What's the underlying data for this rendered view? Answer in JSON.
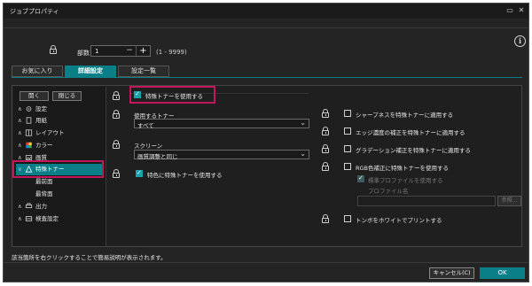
{
  "window": {
    "title": "ジョブプロパティ",
    "min_glyph": "▭",
    "close_glyph": "✕"
  },
  "copies": {
    "label": "部数",
    "value": "1",
    "minus": "−",
    "plus": "+",
    "range": "(1 - 9999)"
  },
  "info_glyph": "i",
  "tabs": [
    {
      "label": "お気に入り",
      "active": false
    },
    {
      "label": "詳細設定",
      "active": true
    },
    {
      "label": "設定一覧",
      "active": false
    }
  ],
  "tree": {
    "open_label": "開く",
    "close_label": "閉じる",
    "items": [
      {
        "label": "設定",
        "icon": "gear-icon",
        "chev": "∧"
      },
      {
        "label": "用紙",
        "icon": "paper-icon",
        "chev": "∧"
      },
      {
        "label": "レイアウト",
        "icon": "layout-icon",
        "chev": "∧"
      },
      {
        "label": "カラー",
        "icon": "color-icon",
        "chev": "∧"
      },
      {
        "label": "画質",
        "icon": "image-icon",
        "chev": "∧"
      },
      {
        "label": "特殊トナー",
        "icon": "special-toner-icon",
        "chev": "∨"
      },
      {
        "label": "最前面",
        "icon": "",
        "chev": ""
      },
      {
        "label": "最背面",
        "icon": "",
        "chev": ""
      },
      {
        "label": "出力",
        "icon": "output-icon",
        "chev": "∧"
      },
      {
        "label": "検査設定",
        "icon": "inspection-icon",
        "chev": "∧"
      }
    ]
  },
  "main": {
    "use_special_toner": "特殊トナーを使用する",
    "toner_to_use_label": "使用するトナー",
    "toner_to_use_value": "すべて",
    "screen_label": "スクリーン",
    "screen_value": "画質調整と同じ",
    "use_special_on_special": "特色に特殊トナーを使用する",
    "right": [
      "シャープネスを特殊トナーに適用する",
      "エッジ濃度の補正を特殊トナーに適用する",
      "グラデーション補正を特殊トナーに適用する",
      "RGB色補正に特殊トナーを使用する"
    ],
    "use_standard_profile": "標準プロファイルを使用する",
    "profile_name_label": "プロファイル名",
    "browse_label": "参照...",
    "print_toner_as_white": "トンボをホワイトでプリントする"
  },
  "status_text": "該当箇所を右クリックすることで簡易説明が表示されます。",
  "buttons": {
    "cancel": "キャンセル(C)",
    "ok": "OK"
  },
  "colors": {
    "accent": "#0a7f88",
    "highlight": "#c2185b",
    "background": "#242424"
  }
}
